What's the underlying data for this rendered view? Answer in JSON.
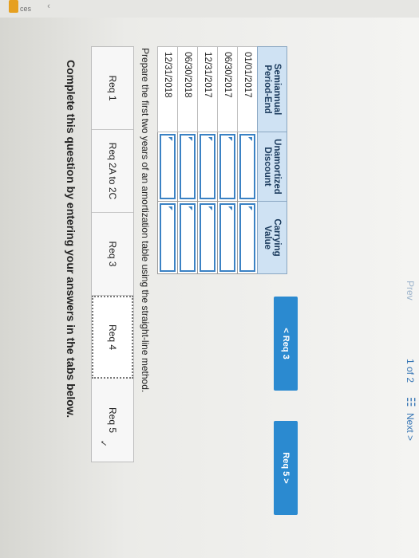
{
  "instruction": "Complete this question by entering your answers in the tabs below.",
  "tabs": [
    {
      "label": "Req 1"
    },
    {
      "label": "Req 2A to 2C"
    },
    {
      "label": "Req 3"
    },
    {
      "label": "Req 4",
      "active": true
    },
    {
      "label": "Req 5",
      "check": "✓"
    }
  ],
  "prompt": "Prepare the first two years of an amortization table using the straight-line method.",
  "table": {
    "headers": [
      "Semiannual Period-End",
      "Unamortized Discount",
      "Carrying Value"
    ],
    "rows": [
      {
        "period": "01/01/2017",
        "discount": "",
        "carrying": ""
      },
      {
        "period": "06/30/2017",
        "discount": "",
        "carrying": ""
      },
      {
        "period": "12/31/2017",
        "discount": "",
        "carrying": ""
      },
      {
        "period": "06/30/2018",
        "discount": "",
        "carrying": ""
      },
      {
        "period": "12/31/2018",
        "discount": "",
        "carrying": ""
      }
    ]
  },
  "buttons": {
    "prev": "< Req 3",
    "next": "Req 5 >"
  },
  "pager": {
    "prev": "Prev",
    "position": "1 of 2",
    "next": "Next >"
  },
  "left_strip_text": "ces",
  "colors": {
    "button_blue": "#2b8ad0",
    "header_blue": "#cfe2f3",
    "input_border": "#3b82c4"
  }
}
